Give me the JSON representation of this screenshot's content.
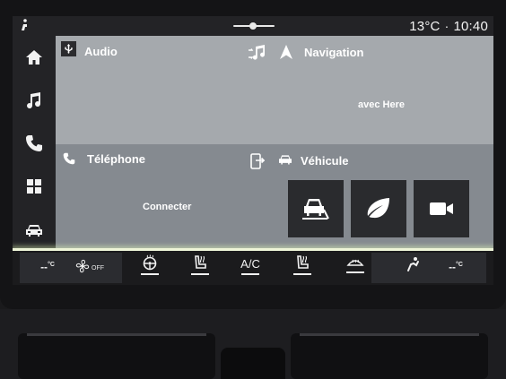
{
  "status": {
    "temperature": "13°C",
    "separator": "·",
    "time": "10:40"
  },
  "sidebar": {
    "items": [
      {
        "id": "home",
        "icon": "home-icon",
        "active": true
      },
      {
        "id": "music",
        "icon": "music-note-icon"
      },
      {
        "id": "phone",
        "icon": "phone-icon"
      },
      {
        "id": "apps",
        "icon": "apps-grid-icon"
      },
      {
        "id": "vehicle",
        "icon": "car-icon"
      }
    ]
  },
  "tiles": {
    "audio": {
      "title": "Audio",
      "source_icon": "usb-icon",
      "action_icon": "music-shuffle-icon"
    },
    "navigation": {
      "title": "Navigation",
      "body": "avec Here",
      "icon": "navigation-arrow-icon"
    },
    "phone": {
      "title": "Téléphone",
      "body": "Connecter",
      "icon": "phone-icon",
      "action_icon": "phone-link-icon"
    },
    "vehicle": {
      "title": "Véhicule",
      "icon": "car-icon",
      "buttons": [
        {
          "id": "driving-assist",
          "icon": "lane-assist-icon"
        },
        {
          "id": "eco",
          "icon": "leaf-icon"
        },
        {
          "id": "camera",
          "icon": "camera-icon"
        }
      ]
    }
  },
  "climate": {
    "left_temp": "--",
    "left_unit": "°C",
    "fan_label": "OFF",
    "ac_label": "A/C",
    "right_temp": "--",
    "right_unit": "°C"
  },
  "colors": {
    "tile_light": "#a5a9ad",
    "tile_dark": "#858a90",
    "glow": "#eef5d8",
    "screen_bg": "#232326"
  }
}
